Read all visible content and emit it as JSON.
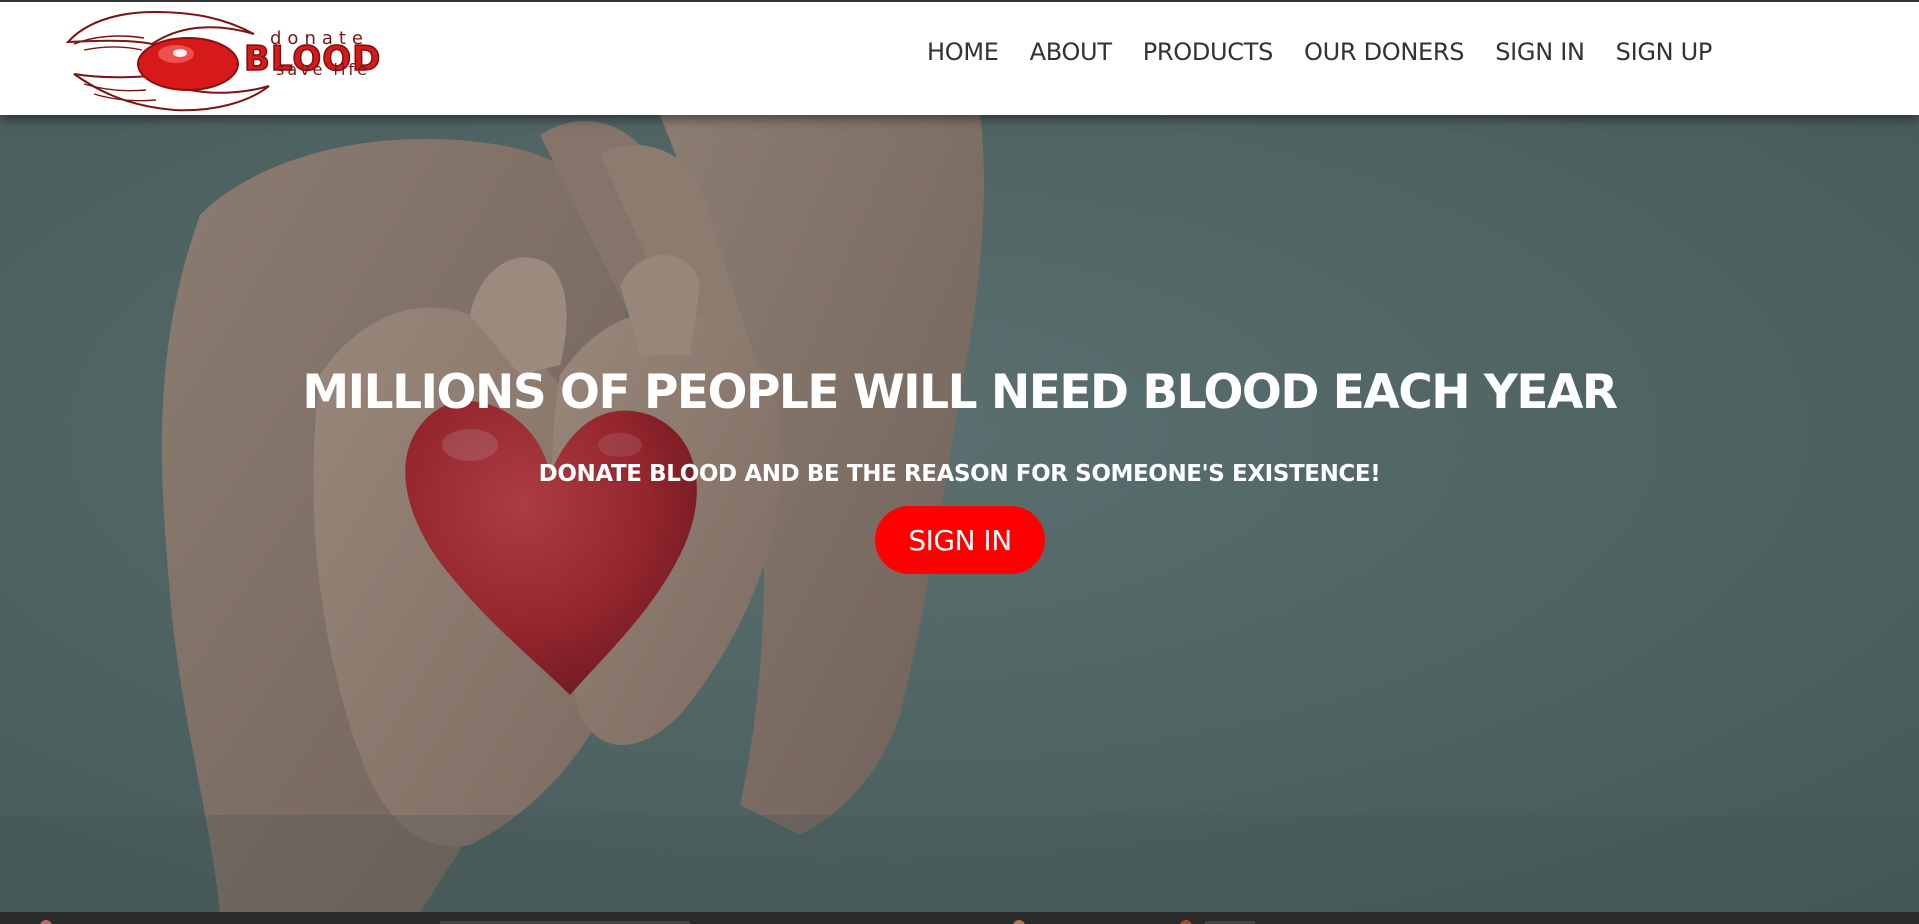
{
  "logo": {
    "top_text": "donate",
    "main_text": "BLOOD",
    "bottom_text": "save life"
  },
  "nav": {
    "items": [
      {
        "label": "HOME"
      },
      {
        "label": "ABOUT"
      },
      {
        "label": "PRODUCTS"
      },
      {
        "label": "OUR DONERS"
      },
      {
        "label": "SIGN IN"
      },
      {
        "label": "SIGN UP"
      }
    ]
  },
  "hero": {
    "title": "MILLIONS OF PEOPLE WILL NEED BLOOD EACH YEAR",
    "subtitle": "DONATE BLOOD AND BE THE REASON FOR SOMEONE'S EXISTENCE!",
    "button_label": "SIGN IN",
    "background_image": "hands-holding-red-heart"
  },
  "colors": {
    "accent": "#ff0000",
    "logo_red": "#d61a1a",
    "logo_dark": "#7a0f0f",
    "nav_text": "#333333",
    "hero_bg": "#5d7070"
  }
}
